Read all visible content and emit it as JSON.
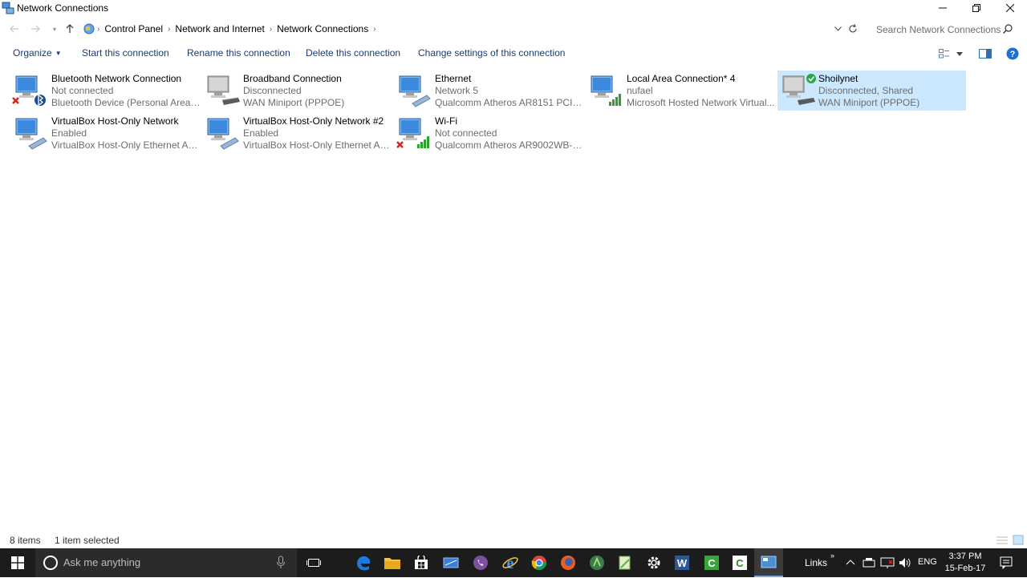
{
  "window": {
    "title": "Network Connections"
  },
  "address": {
    "breadcrumbs": [
      "Control Panel",
      "Network and Internet",
      "Network Connections"
    ]
  },
  "search": {
    "placeholder": "Search Network Connections"
  },
  "commands": {
    "organize": "Organize",
    "start": "Start this connection",
    "rename": "Rename this connection",
    "delete": "Delete this connection",
    "change": "Change settings of this connection"
  },
  "connections": [
    {
      "name": "Bluetooth Network Connection",
      "status": "Not connected",
      "device": "Bluetooth Device (Personal Area ...",
      "icon": "bluetooth-adapter-icon",
      "badge": "red-x",
      "selected": false
    },
    {
      "name": "Broadband Connection",
      "status": "Disconnected",
      "device": "WAN Miniport (PPPOE)",
      "icon": "broadband-modem-icon",
      "badge": "",
      "selected": false
    },
    {
      "name": "Ethernet",
      "status": "Network  5",
      "device": "Qualcomm Atheros AR8151 PCI-E...",
      "icon": "ethernet-adapter-icon",
      "badge": "",
      "selected": false
    },
    {
      "name": "Local Area Connection* 4",
      "status": "nufael",
      "device": "Microsoft Hosted Network Virtual...",
      "icon": "wifi-adapter-icon",
      "badge": "signal",
      "selected": false
    },
    {
      "name": "Shoilynet",
      "status": "Disconnected, Shared",
      "device": "WAN Miniport (PPPOE)",
      "icon": "broadband-modem-icon",
      "badge": "green-check",
      "selected": true
    },
    {
      "name": "VirtualBox Host-Only Network",
      "status": "Enabled",
      "device": "VirtualBox Host-Only Ethernet Ad...",
      "icon": "ethernet-adapter-icon",
      "badge": "",
      "selected": false
    },
    {
      "name": "VirtualBox Host-Only Network #2",
      "status": "Enabled",
      "device": "VirtualBox Host-Only Ethernet Ad...",
      "icon": "ethernet-adapter-icon",
      "badge": "",
      "selected": false
    },
    {
      "name": "Wi-Fi",
      "status": "Not connected",
      "device": "Qualcomm Atheros AR9002WB-1...",
      "icon": "wifi-adapter-icon",
      "badge": "red-x-signal",
      "selected": false
    }
  ],
  "status": {
    "items": "8 items",
    "selected": "1 item selected"
  },
  "taskbar": {
    "search_placeholder": "Ask me anything",
    "links_label": "Links",
    "language": "ENG",
    "time": "3:37 PM",
    "date": "15-Feb-17"
  },
  "colors": {
    "selection": "#cce8ff",
    "taskbar": "#1c1c1c",
    "command_text": "#1a3c6e",
    "muted_text": "#6d6d6d"
  }
}
